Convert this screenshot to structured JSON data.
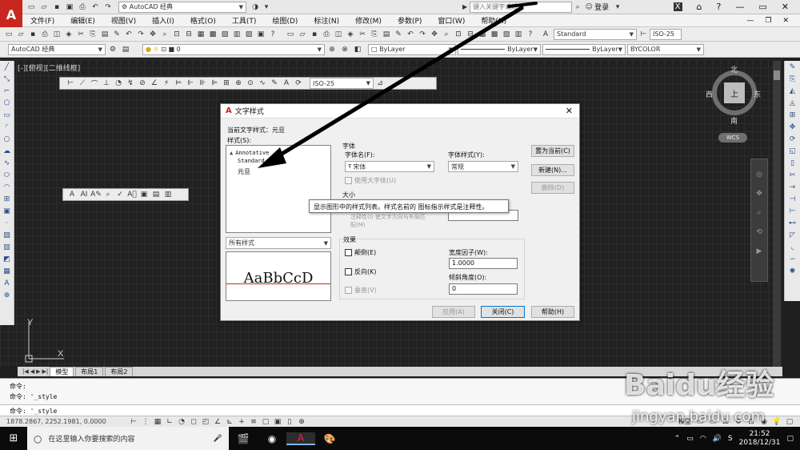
{
  "app": {
    "workspace": "AutoCAD 经典",
    "search_placeholder": "键入关键字或短语",
    "login": "登录",
    "view_label": "[-][俯视][二维线框]"
  },
  "menu": [
    "文件(F)",
    "编辑(E)",
    "视图(V)",
    "插入(I)",
    "格式(O)",
    "工具(T)",
    "绘图(D)",
    "标注(N)",
    "修改(M)",
    "参数(P)",
    "窗口(W)",
    "帮助(H)"
  ],
  "toolbar": {
    "text_style": "Standard",
    "dim_style_right": "ISO-25",
    "workspace_combo": "AutoCAD 经典",
    "layer": "0",
    "color": "ByLayer",
    "linetype": "ByLayer",
    "lineweight": "ByLayer",
    "plotstyle": "BYCOLOR",
    "dim_style_float": "ISO-25"
  },
  "viewcube": {
    "north": "北",
    "south": "南",
    "east": "东",
    "west": "西",
    "top": "上",
    "wcs": "WCS"
  },
  "dialog": {
    "title": "文字样式",
    "current_style_label": "当前文字样式：",
    "current_style_value": "元旦",
    "styles_label": "样式(S):",
    "styles": [
      "Annotative",
      "Standard",
      "元旦"
    ],
    "filter": "所有样式",
    "preview_text": "AaBbCcD",
    "font_group": "字体",
    "font_name_label": "字体名(F):",
    "font_name_value": "宋体",
    "font_style_label": "字体样式(Y):",
    "font_style_value": "常规",
    "big_font": "使用大字体(U)",
    "size_group": "大小",
    "size_hidden": "注释性(I) 使文字方向与布局匹配(M)",
    "tooltip": "显示图形中的样式列表。样式名前的 图标指示样式是注释性。",
    "effects_group": "效果",
    "upside_down": "颠倒(E)",
    "backwards": "反向(K)",
    "vertical": "垂直(V)",
    "width_factor_label": "宽度因子(W):",
    "width_factor_value": "1.0000",
    "oblique_label": "倾斜角度(O):",
    "oblique_value": "0",
    "set_current": "置为当前(C)",
    "new": "新建(N)...",
    "delete": "删除(D)",
    "apply": "应用(A)",
    "close": "关闭(C)",
    "help": "帮助(H)"
  },
  "layout_tabs": [
    "模型",
    "布局1",
    "布局2"
  ],
  "command": {
    "line1": "命令:",
    "line2": "命令: '_style",
    "input": "命令: '_style"
  },
  "status": {
    "coords": "1878.2867, 2252.1981, 0.0000",
    "model": "模型"
  },
  "taskbar": {
    "search": "在这里输入你要搜索的内容",
    "time": "21:52",
    "date": "2018/12/31"
  },
  "watermark": "Baidu经验",
  "watermark_url": "jingyan.baidu.com"
}
